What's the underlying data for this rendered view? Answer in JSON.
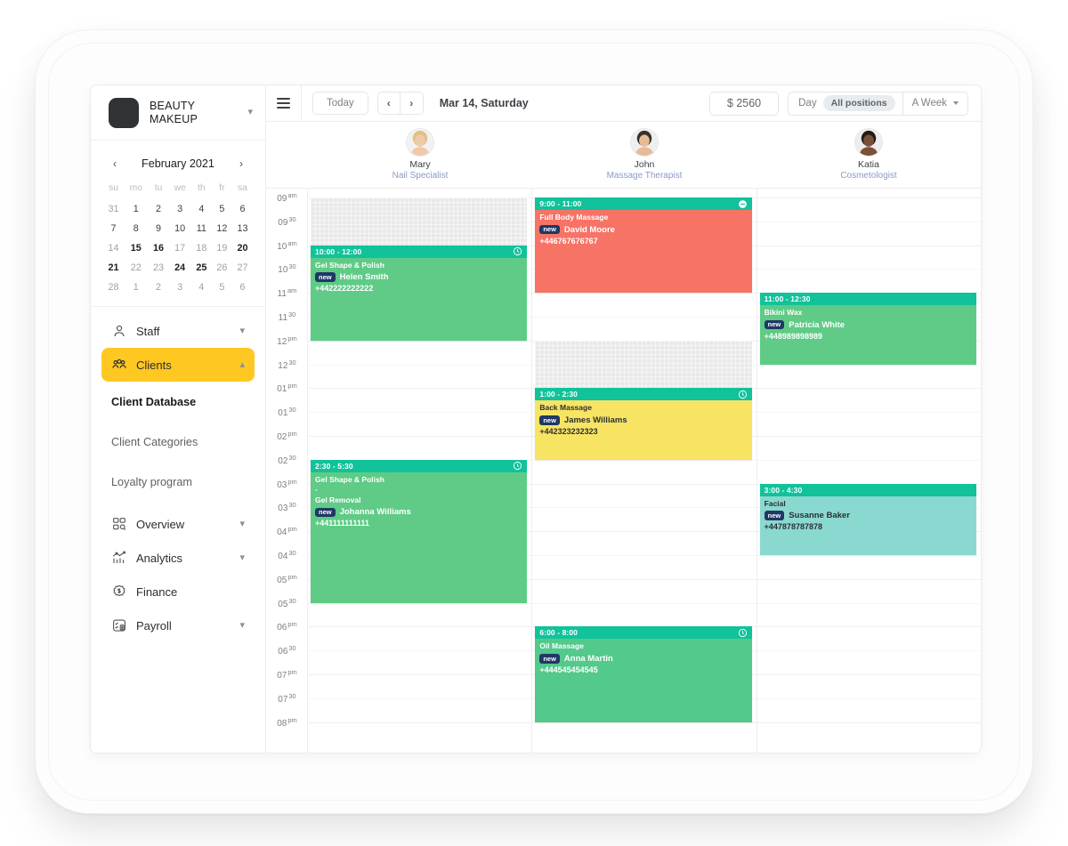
{
  "brand": {
    "line1": "BEAUTY",
    "line2": "MAKEUP",
    "chevron": "chevron-down"
  },
  "calendar": {
    "prev": "‹",
    "next": "›",
    "title": "February 2021",
    "weekdays": [
      "su",
      "mo",
      "tu",
      "we",
      "th",
      "fr",
      "sa"
    ],
    "weeks": [
      [
        {
          "d": "31",
          "t": "out"
        },
        {
          "d": "1",
          "t": "cur"
        },
        {
          "d": "2",
          "t": "cur"
        },
        {
          "d": "3",
          "t": "cur"
        },
        {
          "d": "4",
          "t": "cur"
        },
        {
          "d": "5",
          "t": "cur"
        },
        {
          "d": "6",
          "t": "cur"
        }
      ],
      [
        {
          "d": "7",
          "t": "cur"
        },
        {
          "d": "8",
          "t": "cur"
        },
        {
          "d": "9",
          "t": "cur"
        },
        {
          "d": "10",
          "t": "cur"
        },
        {
          "d": "11",
          "t": "cur"
        },
        {
          "d": "12",
          "t": "cur"
        },
        {
          "d": "13",
          "t": "cur"
        }
      ],
      [
        {
          "d": "14",
          "t": "out"
        },
        {
          "d": "15",
          "t": "hi"
        },
        {
          "d": "16",
          "t": "hi"
        },
        {
          "d": "17",
          "t": "out"
        },
        {
          "d": "18",
          "t": "out"
        },
        {
          "d": "19",
          "t": "out"
        },
        {
          "d": "20",
          "t": "hi"
        }
      ],
      [
        {
          "d": "21",
          "t": "hi"
        },
        {
          "d": "22",
          "t": "out"
        },
        {
          "d": "23",
          "t": "out"
        },
        {
          "d": "24",
          "t": "hi"
        },
        {
          "d": "25",
          "t": "hi"
        },
        {
          "d": "26",
          "t": "out"
        },
        {
          "d": "27",
          "t": "out"
        }
      ],
      [
        {
          "d": "28",
          "t": "out"
        },
        {
          "d": "1",
          "t": "out"
        },
        {
          "d": "2",
          "t": "out"
        },
        {
          "d": "3",
          "t": "out"
        },
        {
          "d": "4",
          "t": "out"
        },
        {
          "d": "5",
          "t": "out"
        },
        {
          "d": "6",
          "t": "out"
        }
      ]
    ]
  },
  "nav": {
    "staff": {
      "label": "Staff",
      "icon": "user-icon",
      "chevron": "chevron-down"
    },
    "clients": {
      "label": "Clients",
      "icon": "users-icon",
      "chevron": "chevron-up",
      "accent": "#FFC722"
    },
    "clients_sub": [
      {
        "label": "Client Database",
        "selected": true
      },
      {
        "label": "Client Categories",
        "selected": false
      },
      {
        "label": "Loyalty program",
        "selected": false
      }
    ],
    "overview": {
      "label": "Overview",
      "icon": "grid-search-icon",
      "chevron": "chevron-down"
    },
    "analytics": {
      "label": "Analytics",
      "icon": "chart-icon",
      "chevron": "chevron-down"
    },
    "finance": {
      "label": "Finance",
      "icon": "dollar-badge-icon",
      "chevron": ""
    },
    "payroll": {
      "label": "Payroll",
      "icon": "payroll-icon",
      "chevron": "chevron-down"
    }
  },
  "toolbar": {
    "menu_icon": "hamburger-icon",
    "today_label": "Today",
    "prev_label": "‹",
    "next_label": "›",
    "date_label": "Mar 14, Saturday",
    "total_label": "$ 2560",
    "day_label": "Day",
    "positions_label": "All positions",
    "range_label": "A Week"
  },
  "staff": [
    {
      "name": "Mary",
      "role": "Nail Specialist",
      "avatar": "avatar-mary"
    },
    {
      "name": "John",
      "role": "Massage Therapist",
      "avatar": "avatar-john"
    },
    {
      "name": "Katia",
      "role": "Cosmetologist",
      "avatar": "avatar-katia"
    }
  ],
  "time_labels": [
    {
      "h": "09",
      "s": "am"
    },
    {
      "h": "09",
      "s": "30"
    },
    {
      "h": "10",
      "s": "am"
    },
    {
      "h": "10",
      "s": "30"
    },
    {
      "h": "11",
      "s": "am"
    },
    {
      "h": "11",
      "s": "30"
    },
    {
      "h": "12",
      "s": "pm"
    },
    {
      "h": "12",
      "s": "30"
    },
    {
      "h": "01",
      "s": "pm"
    },
    {
      "h": "01",
      "s": "30"
    },
    {
      "h": "02",
      "s": "pm"
    },
    {
      "h": "02",
      "s": "30"
    },
    {
      "h": "03",
      "s": "pm"
    },
    {
      "h": "03",
      "s": "30"
    },
    {
      "h": "04",
      "s": "pm"
    },
    {
      "h": "04",
      "s": "30"
    },
    {
      "h": "05",
      "s": "pm"
    },
    {
      "h": "05",
      "s": "30"
    },
    {
      "h": "06",
      "s": "pm"
    },
    {
      "h": "06",
      "s": "30"
    },
    {
      "h": "07",
      "s": "pm"
    },
    {
      "h": "07",
      "s": "30"
    },
    {
      "h": "08",
      "s": "pm"
    }
  ],
  "appointments": [
    {
      "column": 0,
      "start": 10.0,
      "end": 12.0,
      "time": "10:00 - 12:00",
      "service": "Gel Shape & Polish",
      "service2": "",
      "badge": "new",
      "client": "Helen Smith",
      "phone": "+442222222222",
      "color": "#5fcb86",
      "header_color": "#11c29a",
      "icon": "clock-icon",
      "text": "light"
    },
    {
      "column": 0,
      "start": 14.5,
      "end": 17.5,
      "time": "2:30 - 5:30",
      "service": "Gel Shape & Polish",
      "service2": "Gel Removal",
      "badge": "new",
      "client": "Johanna Williams",
      "phone": "+441111111111",
      "color": "#5fcb86",
      "header_color": "#11c29a",
      "icon": "clock-icon",
      "text": "light"
    },
    {
      "column": 1,
      "start": 9.0,
      "end": 11.0,
      "time": "9:00 - 11:00",
      "service": "Full Body Massage",
      "service2": "",
      "badge": "new",
      "client": "David Moore",
      "phone": "+446767676767",
      "color": "#f77366",
      "header_color": "#11c29a",
      "icon": "minus-circle-icon",
      "text": "light"
    },
    {
      "column": 1,
      "start": 13.0,
      "end": 14.5,
      "time": "1:00 - 2:30",
      "service": "Back Massage",
      "service2": "",
      "badge": "new",
      "client": "James Williams",
      "phone": "+442323232323",
      "color": "#f7e463",
      "header_color": "#11c29a",
      "icon": "clock-icon",
      "text": "dark"
    },
    {
      "column": 1,
      "start": 18.0,
      "end": 20.0,
      "time": "6:00 - 8:00",
      "service": "Oil Massage",
      "service2": "",
      "badge": "new",
      "client": "Anna Martin",
      "phone": "+444545454545",
      "color": "#53c98b",
      "header_color": "#11c29a",
      "icon": "clock-icon",
      "text": "light"
    },
    {
      "column": 2,
      "start": 11.0,
      "end": 12.5,
      "time": "11:00 - 12:30",
      "service": "Bikini Wax",
      "service2": "",
      "badge": "new",
      "client": "Patricia White",
      "phone": "+448989898989",
      "color": "#5fcb86",
      "header_color": "#11c29a",
      "icon": "",
      "text": "light"
    },
    {
      "column": 2,
      "start": 15.0,
      "end": 16.5,
      "time": "3:00 - 4:30",
      "service": "Facial",
      "service2": "",
      "badge": "new",
      "client": "Susanne Baker",
      "phone": "+447878787878",
      "color": "#8ad9d0",
      "header_color": "#11c29a",
      "icon": "",
      "text": "dark"
    }
  ],
  "blocked_slots": [
    {
      "column": 0,
      "start": 9.0,
      "end": 10.0
    },
    {
      "column": 1,
      "start": 12.0,
      "end": 13.0
    }
  ]
}
